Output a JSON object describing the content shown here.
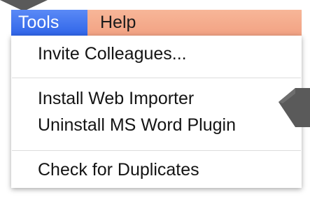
{
  "menubar": {
    "tools_label": "Tools",
    "help_label": "Help"
  },
  "dropdown": {
    "items": [
      {
        "label": "Invite Colleagues..."
      },
      {
        "label": "Install Web Importer"
      },
      {
        "label": "Uninstall MS Word Plugin"
      },
      {
        "label": "Check for Duplicates"
      }
    ]
  },
  "colors": {
    "tools_active": "#3b73f0",
    "help_background": "#f5a88a",
    "annotation_arrow": "#5a5a5a"
  },
  "icons": {
    "top_annotation": "arrow-down-icon",
    "right_annotation": "arrow-left-icon"
  }
}
